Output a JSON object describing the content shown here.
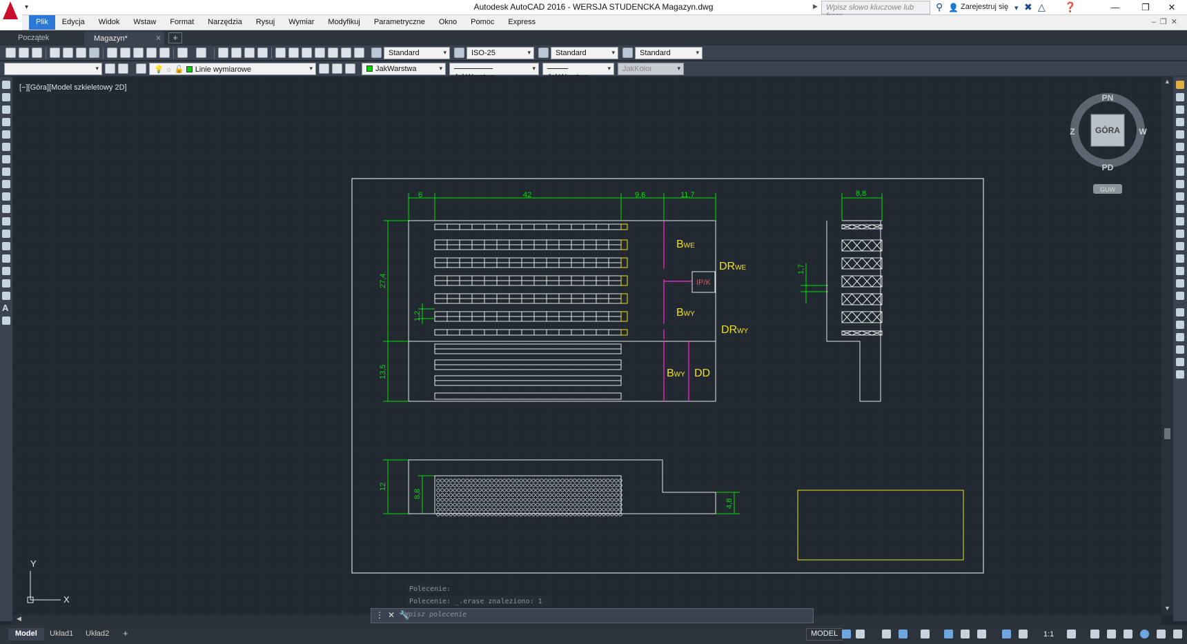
{
  "window": {
    "title": "Autodesk AutoCAD 2016 - WERSJA STUDENCKA    Magazyn.dwg",
    "search_placeholder": "Wpisz słowo kluczowe lub frazę",
    "sign_in": "Zarejestruj się"
  },
  "menu": {
    "items": [
      "Plik",
      "Edycja",
      "Widok",
      "Wstaw",
      "Format",
      "Narzędzia",
      "Rysuj",
      "Wymiar",
      "Modyfikuj",
      "Parametryczne",
      "Okno",
      "Pomoc",
      "Express"
    ]
  },
  "tabs": {
    "start": "Początek",
    "drawing": "Magazyn*"
  },
  "toolbar1": {
    "text_style": "Standard",
    "dim_style": "ISO-25",
    "table_style": "Standard",
    "mleader_style": "Standard"
  },
  "toolbar2": {
    "layer": "Linie wymiarowe",
    "color": "JakWarstwa",
    "linetype": "JakWarstwa",
    "lineweight": "JakWarstwa",
    "plotstyle": "JakKolor"
  },
  "viewport": {
    "label": "[−][Góra][Model szkieletowy 2D]"
  },
  "viewcube": {
    "north": "PN",
    "south": "PD",
    "east": "W",
    "west": "Z",
    "face": "GÓRA",
    "wcs": "GUW"
  },
  "ucs": {
    "x": "X",
    "y": "Y"
  },
  "drawing": {
    "dims": {
      "d6": "6",
      "d42": "42",
      "d96": "9,6",
      "d117": "11,7",
      "d88top": "8,8",
      "d274": "27,4",
      "d12small": "1,2",
      "d135": "13,5",
      "d17": "1,7",
      "d12": "12",
      "d88": "8,8",
      "d48": "4,8"
    },
    "labels": {
      "b": "B",
      "we": "WE",
      "wy": "WY",
      "dr": "DR",
      "ipk": "IP/K",
      "dd": "DD"
    }
  },
  "command": {
    "history1": "Polecenie:",
    "history2": "Polecenie: _.erase znaleziono: 1",
    "placeholder": "Wpisz polecenie"
  },
  "layout_tabs": [
    "Model",
    "Układ1",
    "Układ2"
  ],
  "status": {
    "model": "MODEL",
    "scale": "1:1"
  }
}
